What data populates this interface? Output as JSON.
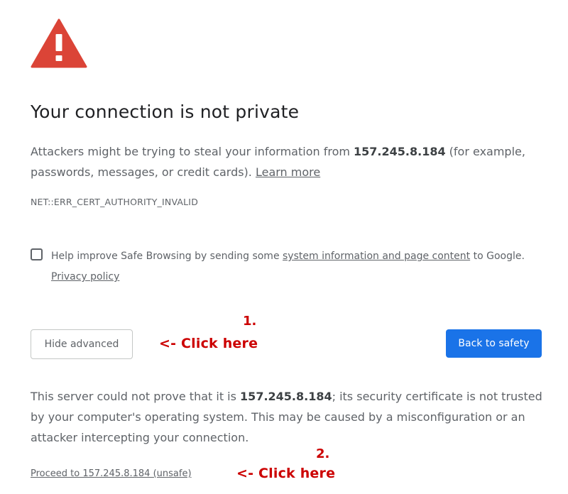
{
  "header": {
    "title": "Your connection is not private"
  },
  "message": {
    "prefix": "Attackers might be trying to steal your information from ",
    "host": "157.245.8.184",
    "suffix": " (for example, passwords, messages, or credit cards). ",
    "learn_more": "Learn more"
  },
  "error_code": "NET::ERR_CERT_AUTHORITY_INVALID",
  "safe_browsing": {
    "checked": false,
    "text_prefix": "Help improve Safe Browsing by sending some ",
    "link_text": "system information and page content",
    "text_suffix": " to Google.",
    "privacy_link": "Privacy policy"
  },
  "buttons": {
    "hide_advanced": "Hide advanced",
    "back_to_safety": "Back to safety"
  },
  "details": {
    "prefix": "This server could not prove that it is ",
    "host": "157.245.8.184",
    "suffix": "; its security certificate is not trusted by your computer's operating system. This may be caused by a misconfiguration or an attacker intercepting your connection."
  },
  "proceed_link": "Proceed to 157.245.8.184 (unsafe)",
  "annotations": {
    "step1_number": "1.",
    "step1_text": "<- Click here",
    "step2_number": "2.",
    "step2_text": "<- Click here",
    "color": "#cc0000"
  },
  "colors": {
    "warning_icon": "#db4437",
    "primary_button": "#1a73e8",
    "title_text": "#202124",
    "body_text": "#5f6368"
  }
}
